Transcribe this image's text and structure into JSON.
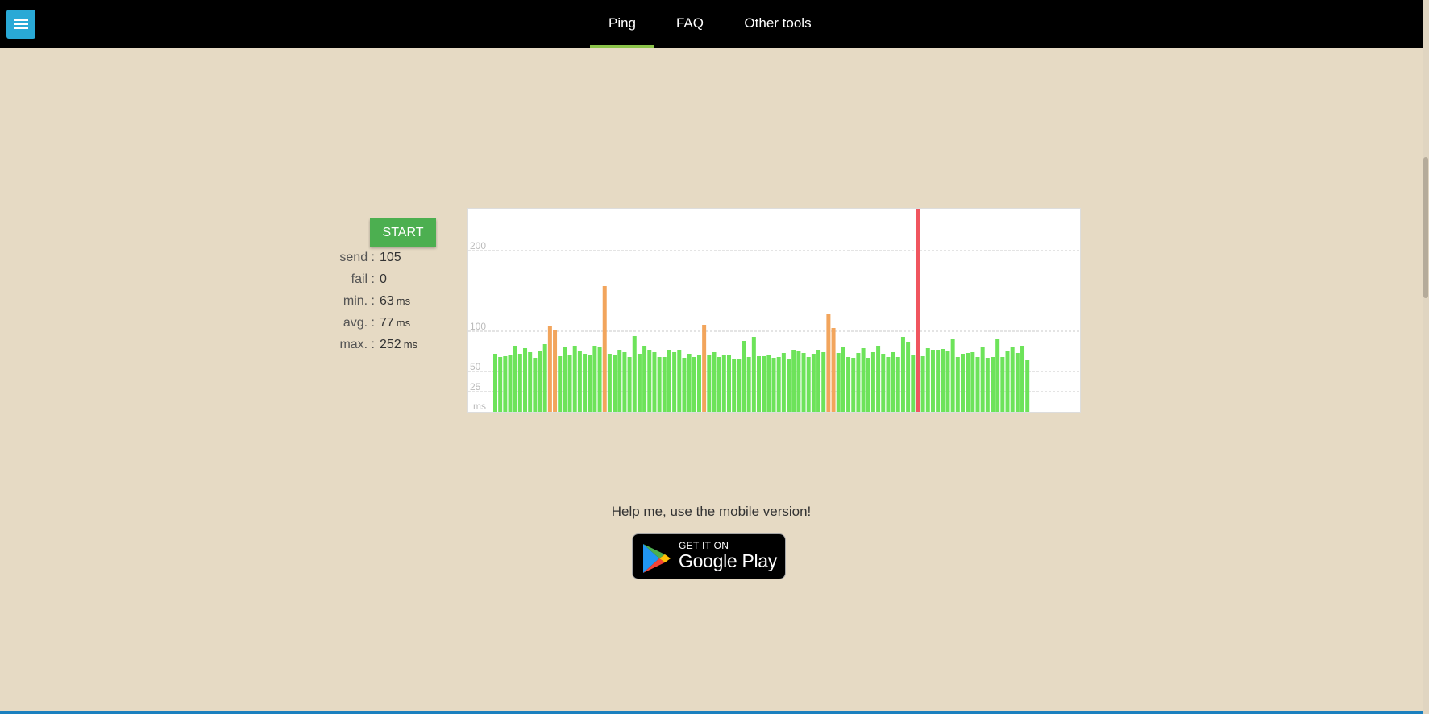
{
  "nav": {
    "items": [
      {
        "label": "Ping",
        "active": true
      },
      {
        "label": "FAQ",
        "active": false
      },
      {
        "label": "Other tools",
        "active": false
      }
    ]
  },
  "controls": {
    "start_label": "START"
  },
  "stats": {
    "send_label": "send :",
    "send_value": "105",
    "fail_label": "fail :",
    "fail_value": "0",
    "min_label": "min. :",
    "min_value": "63",
    "min_unit": "ms",
    "avg_label": "avg. :",
    "avg_value": "77",
    "avg_unit": "ms",
    "max_label": "max. :",
    "max_value": "252",
    "max_unit": "ms"
  },
  "chart_data": {
    "type": "bar",
    "unit_label": "ms",
    "y_ticks": [
      25,
      50,
      100,
      200
    ],
    "ylim": [
      0,
      250
    ],
    "colors": {
      "normal": "#6de35a",
      "warn": "#f2a55c",
      "high": "#f0555f"
    },
    "values": [
      72,
      68,
      69,
      70,
      82,
      72,
      79,
      74,
      67,
      75,
      84,
      107,
      102,
      69,
      80,
      70,
      82,
      76,
      72,
      71,
      82,
      80,
      156,
      72,
      70,
      77,
      74,
      68,
      94,
      72,
      82,
      77,
      74,
      68,
      68,
      77,
      74,
      77,
      67,
      72,
      68,
      70,
      108,
      70,
      74,
      68,
      70,
      71,
      65,
      66,
      88,
      68,
      93,
      69,
      69,
      71,
      67,
      68,
      73,
      66,
      77,
      76,
      73,
      68,
      72,
      77,
      74,
      121,
      104,
      73,
      81,
      68,
      67,
      73,
      79,
      67,
      74,
      82,
      72,
      68,
      74,
      68,
      93,
      87,
      70,
      252,
      69,
      79,
      77,
      77,
      78,
      75,
      90,
      68,
      72,
      73,
      74,
      68,
      80,
      67,
      68,
      90,
      68,
      75,
      81,
      73,
      82,
      64
    ]
  },
  "mobile": {
    "help_text": "Help me, use the mobile version!",
    "badge_small": "GET IT ON",
    "badge_big": "Google Play"
  }
}
